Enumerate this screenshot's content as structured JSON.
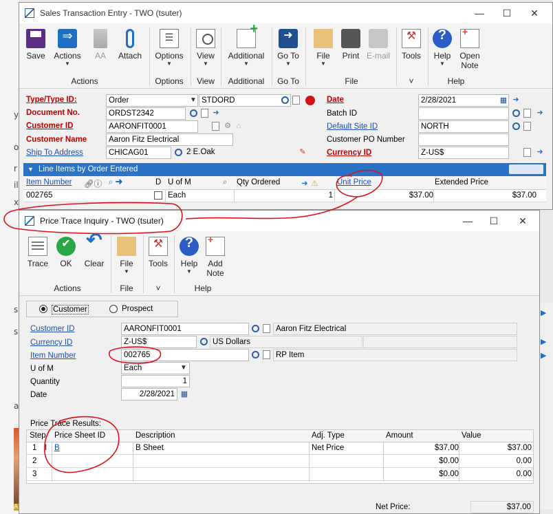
{
  "background": {
    "letters": [
      "y",
      "o",
      "r",
      "il",
      "x",
      "s",
      "s",
      "a",
      "AL"
    ]
  },
  "sales": {
    "title": "Sales Transaction Entry  -  TWO (tsuter)",
    "ribbon": {
      "save": "Save",
      "actions": "Actions",
      "aa": "AA",
      "attach": "Attach",
      "options": "Options",
      "view": "View",
      "additional": "Additional",
      "goto": "Go To",
      "file": "File",
      "print": "Print",
      "email": "E-mail",
      "tools": "Tools",
      "help": "Help",
      "open_note_1": "Open",
      "open_note_2": "Note",
      "group_actions": "Actions",
      "group_options": "Options",
      "group_view": "View",
      "group_additional": "Additional",
      "group_goto": "Go To",
      "group_file": "File",
      "group_tools": "˅",
      "group_help": "Help"
    },
    "form": {
      "type_label": "Type/Type ID:",
      "type_value": "Order",
      "type_id_value": "STDORD",
      "docno_label": "Document No.",
      "docno_value": "ORDST2342",
      "customer_label": "Customer ID",
      "customer_value": "AARONFIT0001",
      "custname_label": "Customer Name",
      "custname_value": "Aaron Fitz Electrical",
      "shipto_label": "Ship To Address",
      "shipto_value": "CHICAG01",
      "shipto_address": "2 E.Oak",
      "date_label": "Date",
      "date_value": "2/28/2021",
      "batch_label": "Batch ID",
      "batch_value": "",
      "site_label": "Default Site ID",
      "site_value": "NORTH",
      "po_label": "Customer PO Number",
      "po_value": "",
      "currency_label": "Currency ID",
      "currency_value": "Z-US$"
    },
    "grid": {
      "bar_title": "Line Items by Order Entered",
      "col_item": "Item Number",
      "col_d": "D",
      "col_uom": "U of M",
      "col_qty": "Qty Ordered",
      "col_price": "Unit Price",
      "col_ext": "Extended Price",
      "row_item": "002765",
      "row_uom": "Each",
      "row_qty": "1",
      "row_price": "$37.00",
      "row_ext": "$37.00"
    }
  },
  "trace": {
    "title": "Price Trace Inquiry  -  TWO (tsuter)",
    "ribbon": {
      "trace": "Trace",
      "ok": "OK",
      "clear": "Clear",
      "file": "File",
      "tools": "Tools",
      "help": "Help",
      "add_note_1": "Add",
      "add_note_2": "Note",
      "group_actions": "Actions",
      "group_file": "File",
      "group_tools": "˅",
      "group_help": "Help"
    },
    "radio_customer": "Customer",
    "radio_prospect": "Prospect",
    "form": {
      "customer_label": "Customer ID",
      "customer_value": "AARONFIT0001",
      "customer_name": "Aaron Fitz Electrical",
      "currency_label": "Currency ID",
      "currency_value": "Z-US$",
      "currency_name": "US Dollars",
      "item_label": "Item Number",
      "item_value": "002765",
      "item_desc": "RP Item",
      "uom_label": "U of M",
      "uom_value": "Each",
      "qty_label": "Quantity",
      "qty_value": "1",
      "date_label": "Date",
      "date_value": "2/28/2021"
    },
    "results_label": "Price Trace Results:",
    "results": {
      "col_step": "Step",
      "col_sheet": "Price Sheet ID",
      "col_desc": "Description",
      "col_adj": "Adj. Type",
      "col_amount": "Amount",
      "col_value": "Value",
      "rows": [
        {
          "step": "1",
          "flag": "I",
          "sheet": "B",
          "desc": "B Sheet",
          "adj": "Net Price",
          "amount": "$37.00",
          "value": "$37.00"
        },
        {
          "step": "2",
          "flag": "",
          "sheet": "",
          "desc": "",
          "adj": "",
          "amount": "$0.00",
          "value": "0.00"
        },
        {
          "step": "3",
          "flag": "",
          "sheet": "",
          "desc": "",
          "adj": "",
          "amount": "$0.00",
          "value": "0.00"
        }
      ]
    },
    "net_price_label": "Net Price:",
    "net_price_value": "$37.00"
  },
  "colors": {
    "accent_blue": "#2b73c6",
    "required_red": "#c00000",
    "annotation_red": "#e0101a",
    "link_blue": "#1a4fb8"
  }
}
